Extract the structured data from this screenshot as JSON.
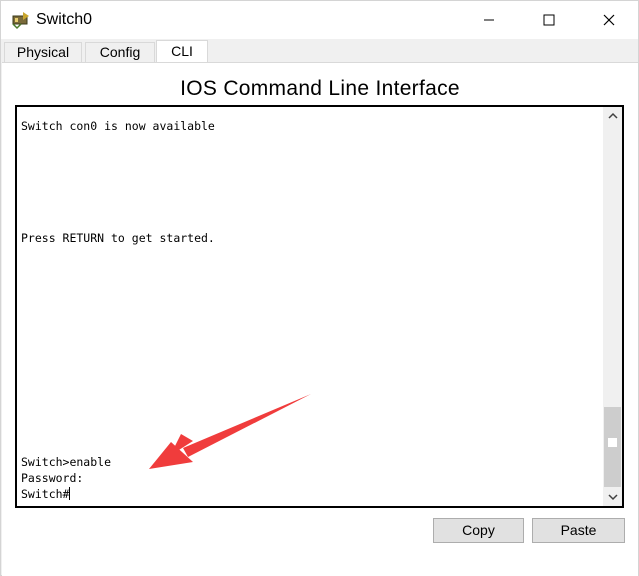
{
  "window": {
    "title": "Switch0"
  },
  "tabs": [
    {
      "label": "Physical"
    },
    {
      "label": "Config"
    },
    {
      "label": "CLI"
    }
  ],
  "main": {
    "heading": "IOS Command Line Interface",
    "terminal_lines": [
      "Switch con0 is now available",
      "Press RETURN to get started.",
      "Switch>enable",
      "Password:",
      "Switch#"
    ]
  },
  "buttons": {
    "copy": "Copy",
    "paste": "Paste"
  },
  "colors": {
    "annotation_arrow": "#f03c3c"
  }
}
